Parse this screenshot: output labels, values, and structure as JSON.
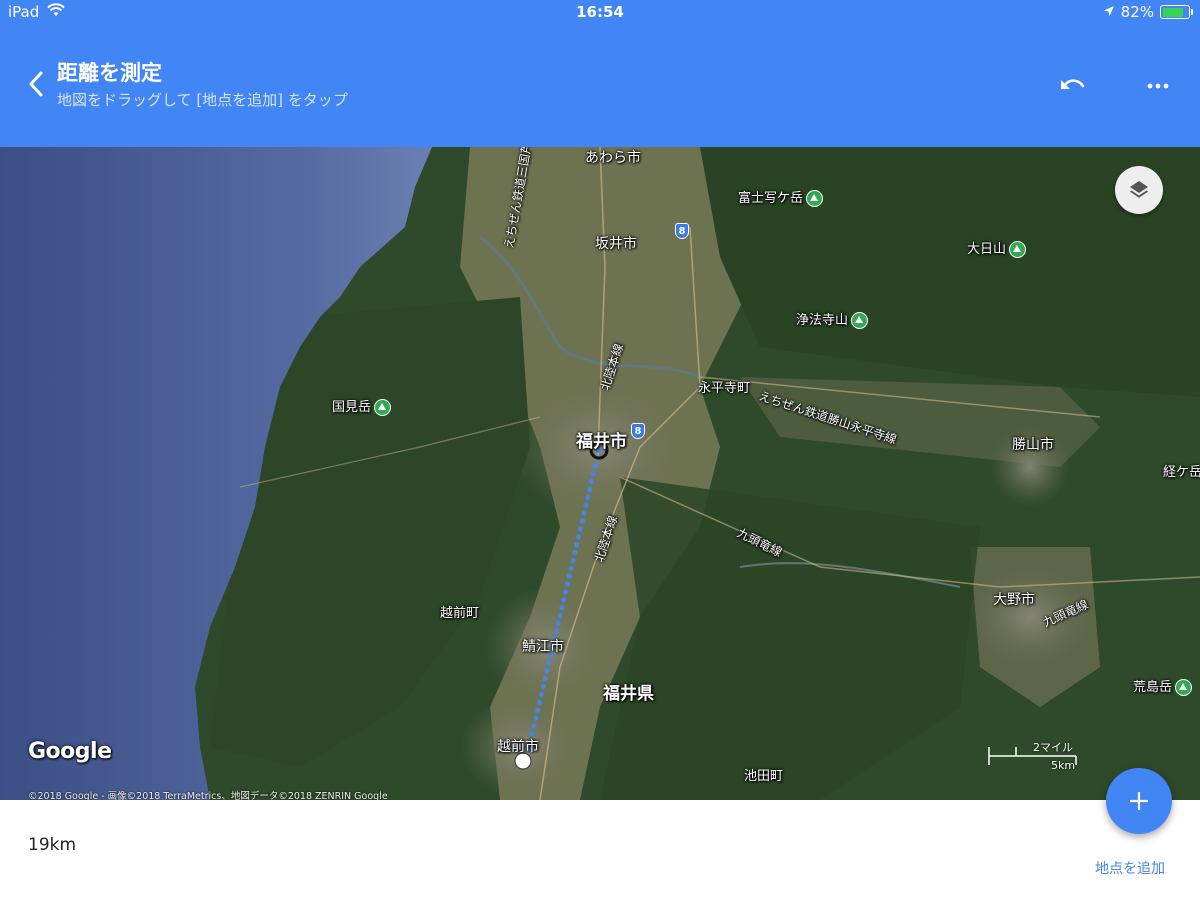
{
  "status_bar": {
    "device": "iPad",
    "time": "16:54",
    "battery": "82%",
    "battery_level": 0.82
  },
  "header": {
    "title": "距離を測定",
    "subtitle": "地図をドラッグして [地点を追加] をタップ"
  },
  "map": {
    "labels": {
      "awara": "あわら市",
      "sakai": "坂井市",
      "fujishaga": "富士写ケ岳",
      "dainichi": "大日山",
      "joho": "浄法寺山",
      "kunimi": "国見岳",
      "fukui_city": "福井市",
      "eiheiji": "永平寺町",
      "katsuyama": "勝山市",
      "kyouga": "経ケ岳",
      "echizen_town": "越前町",
      "sabae": "鯖江市",
      "fukui_pref": "福井県",
      "ono": "大野市",
      "arashima": "荒島岳",
      "echizen_city": "越前市",
      "ikeda": "池田町",
      "rail_mikuni": "えちぜん鉄道三国芦原線",
      "rail_hokuriku_n": "北陸本線",
      "rail_hokuriku_s": "北陸本線",
      "rail_katsuyama": "えちぜん鉄道勝山永平寺線",
      "rail_kuzuryu_w": "九頭竜線",
      "rail_kuzuryu_e": "九頭竜線",
      "route_8a": "8",
      "route_8b": "8"
    },
    "logo": "Google",
    "copyright": "©2018 Google - 画像©2018 TerraMetrics、地図データ©2018 ZENRIN Google",
    "scale_miles": "2マイル",
    "scale_km": "5km"
  },
  "measure": {
    "distance": "19km",
    "add_point": "地点を追加"
  },
  "colors": {
    "header": "#4285f4",
    "route": "#4285f4",
    "peak": "#34a853"
  }
}
